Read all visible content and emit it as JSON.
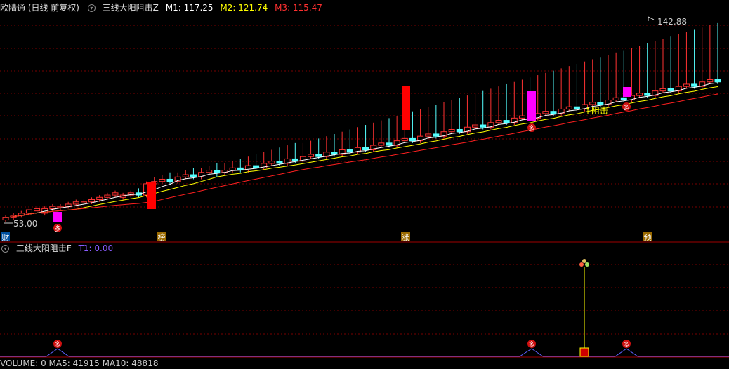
{
  "main_panel": {
    "title": "欧陆通 (日线 前复权)",
    "indicator_name": "三线大阳阻击Z",
    "m1_label": "M1: 117.25",
    "m2_label": "M2: 121.74",
    "m3_label": "M3: 115.47",
    "high_label": "142.88",
    "low_label": "53.00",
    "annotation_resist": "↑阻击",
    "buy_badge": "多",
    "event_markers": [
      "财",
      "榜",
      "涨",
      "预"
    ],
    "colors": {
      "up": "#ff3232",
      "down": "#54ffff",
      "m1": "#ffffff",
      "m2": "#ffff00",
      "m3": "#ff2020",
      "strong": "#ff00ff"
    }
  },
  "sub_panel": {
    "indicator_name": "三线大阳阻击F",
    "t1_label": "T1: 0.00",
    "buy_badge": "多"
  },
  "volume_panel": {
    "label": "VOLUME: 0  MA5: 41915  MA10: 48818"
  },
  "chart_data": {
    "type": "candlestick",
    "y_range": [
      53.0,
      142.88
    ],
    "candles": [
      [
        55,
        56,
        54,
        57
      ],
      [
        56,
        57,
        55,
        58
      ],
      [
        57,
        58,
        56,
        59
      ],
      [
        58,
        59.5,
        57,
        60
      ],
      [
        59,
        60,
        58,
        61
      ],
      [
        58,
        60,
        57,
        61
      ],
      [
        60,
        61,
        59,
        62
      ],
      [
        60.5,
        61,
        59.5,
        62
      ],
      [
        61,
        62,
        60,
        63
      ],
      [
        62,
        63,
        61,
        64
      ],
      [
        62.5,
        63,
        61.5,
        64
      ],
      [
        63,
        64,
        62,
        65
      ],
      [
        64,
        65,
        63,
        66
      ],
      [
        65,
        66,
        64,
        67
      ],
      [
        66,
        67,
        65,
        68
      ],
      [
        65,
        66,
        64,
        67
      ],
      [
        66,
        67,
        65,
        68
      ],
      [
        67,
        66,
        65,
        69
      ],
      [
        66,
        71,
        65,
        72
      ],
      [
        71,
        72,
        70,
        74
      ],
      [
        72,
        73,
        71,
        75
      ],
      [
        73,
        72,
        71,
        76
      ],
      [
        72,
        74,
        71,
        76
      ],
      [
        74,
        75,
        73,
        77
      ],
      [
        75,
        74,
        73,
        78
      ],
      [
        74,
        76,
        73,
        78
      ],
      [
        76,
        77,
        75,
        79
      ],
      [
        77,
        76,
        74,
        80
      ],
      [
        76,
        77,
        75,
        80
      ],
      [
        77,
        78,
        76,
        81
      ],
      [
        78,
        77,
        76,
        82
      ],
      [
        77,
        79,
        76,
        83
      ],
      [
        79,
        78,
        77,
        84
      ],
      [
        78,
        80,
        77,
        85
      ],
      [
        80,
        81,
        79,
        86
      ],
      [
        81,
        80,
        79,
        87
      ],
      [
        80,
        82,
        79,
        88
      ],
      [
        82,
        81,
        80,
        89
      ],
      [
        81,
        83,
        80,
        89
      ],
      [
        83,
        84,
        82,
        90
      ],
      [
        84,
        83,
        82,
        91
      ],
      [
        83,
        85,
        82,
        92
      ],
      [
        85,
        84,
        83,
        93
      ],
      [
        84,
        86,
        83,
        94
      ],
      [
        86,
        85,
        84,
        95
      ],
      [
        85,
        87,
        84,
        96
      ],
      [
        87,
        86,
        85,
        97
      ],
      [
        86,
        88,
        85,
        98
      ],
      [
        88,
        89,
        87,
        99
      ],
      [
        89,
        88,
        87,
        100
      ],
      [
        88,
        90,
        87,
        101
      ],
      [
        90,
        91,
        89,
        102
      ],
      [
        91,
        90,
        89,
        103
      ],
      [
        90,
        92,
        89,
        104
      ],
      [
        92,
        93,
        91,
        105
      ],
      [
        93,
        92,
        91,
        106
      ],
      [
        92,
        94,
        91,
        107
      ],
      [
        94,
        95,
        93,
        108
      ],
      [
        95,
        94,
        93,
        109
      ],
      [
        94,
        96,
        93,
        110
      ],
      [
        96,
        97,
        95,
        111
      ],
      [
        97,
        96,
        95,
        112
      ],
      [
        96,
        98,
        95,
        113
      ],
      [
        98,
        99,
        97,
        114
      ],
      [
        99,
        98,
        97,
        115
      ],
      [
        98,
        100,
        97,
        116
      ],
      [
        100,
        101,
        99,
        117
      ],
      [
        101,
        100,
        99,
        118
      ],
      [
        100,
        102,
        99,
        119
      ],
      [
        102,
        103,
        101,
        120
      ],
      [
        103,
        102,
        101,
        121
      ],
      [
        102,
        104,
        101,
        122
      ],
      [
        104,
        105,
        103,
        123
      ],
      [
        105,
        104,
        103,
        124
      ],
      [
        104,
        106,
        103,
        125
      ],
      [
        106,
        107,
        105,
        126
      ],
      [
        107,
        106,
        105,
        127
      ],
      [
        106,
        108,
        105,
        128
      ],
      [
        108,
        109,
        107,
        129
      ],
      [
        109,
        108,
        107,
        130
      ],
      [
        108,
        110,
        107,
        131
      ],
      [
        110,
        111,
        109,
        132
      ],
      [
        111,
        110,
        109,
        133
      ],
      [
        110,
        112,
        109,
        134
      ],
      [
        112,
        113,
        111,
        135
      ],
      [
        113,
        112,
        111,
        136
      ],
      [
        112,
        114,
        111,
        137
      ],
      [
        114,
        115,
        113,
        138
      ],
      [
        115,
        114,
        113,
        139
      ],
      [
        114,
        116,
        113,
        140
      ],
      [
        116,
        117,
        115,
        141
      ],
      [
        117,
        116,
        115,
        142
      ]
    ],
    "note": "candles as [open, close, low, high]"
  }
}
